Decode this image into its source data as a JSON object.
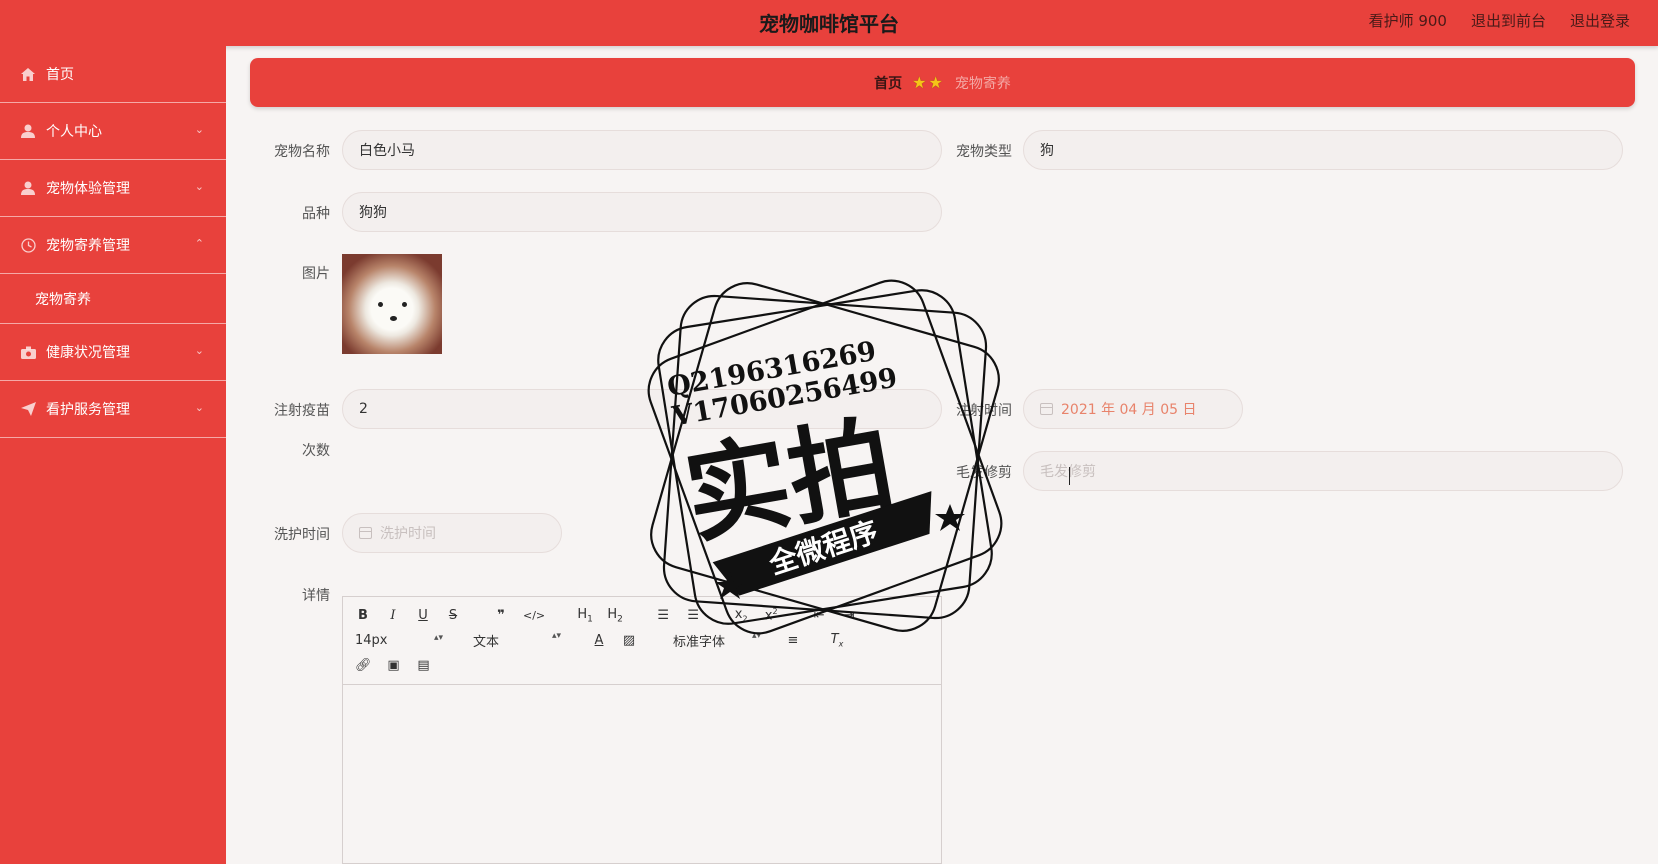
{
  "header": {
    "title": "宠物咖啡馆平台",
    "user": "看护师 900",
    "to_front": "退出到前台",
    "logout": "退出登录"
  },
  "sidebar": {
    "items": [
      {
        "label": "首页",
        "icon": "home-icon"
      },
      {
        "label": "个人中心",
        "icon": "user-icon"
      },
      {
        "label": "宠物体验管理",
        "icon": "user-icon"
      },
      {
        "label": "宠物寄养管理",
        "icon": "clock-icon"
      },
      {
        "label": "健康状况管理",
        "icon": "camera-icon"
      },
      {
        "label": "看护服务管理",
        "icon": "send-icon"
      }
    ],
    "submenu": {
      "label": "宠物寄养"
    }
  },
  "breadcrumb": {
    "home": "首页",
    "current": "宠物寄养"
  },
  "form": {
    "pet_name_label": "宠物名称",
    "pet_name_value": "白色小马",
    "pet_type_label": "宠物类型",
    "pet_type_value": "狗",
    "breed_label": "品种",
    "breed_value": "狗狗",
    "image_label": "图片",
    "vaccine_count_label_1": "注射疫苗",
    "vaccine_count_label_2": "次数",
    "vaccine_count_value": "2",
    "vaccine_time_label": "注射时间",
    "vaccine_time_value": "2021 年 04 月 05 日",
    "grooming_label": "毛发修剪",
    "grooming_placeholder": "毛发修剪",
    "wash_time_label": "洗护时间",
    "wash_time_placeholder": "洗护时间",
    "details_label": "详情"
  },
  "editor": {
    "font_size": "14px",
    "text_type": "文本",
    "font_family": "标准字体"
  },
  "watermark": {
    "line1": "Q2196316269",
    "line2": "V17060256499",
    "big": "实拍",
    "ribbon": "全微程序"
  }
}
